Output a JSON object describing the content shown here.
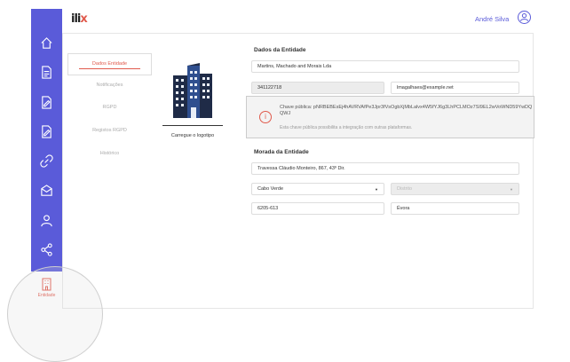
{
  "app": {
    "logo_text": "ilix",
    "logo_accent_color": "#e05a4c",
    "brand_color": "#5a5bd9"
  },
  "header": {
    "user_name": "André Silva"
  },
  "sidebar": {
    "items": [
      {
        "icon": "home-icon"
      },
      {
        "icon": "document-icon"
      },
      {
        "icon": "edit-document-icon"
      },
      {
        "icon": "edit-document-icon-2"
      },
      {
        "icon": "link-icon"
      },
      {
        "icon": "mail-icon"
      },
      {
        "icon": "user-icon"
      },
      {
        "icon": "share-icon"
      }
    ],
    "active": {
      "icon": "building-icon",
      "label": "Entidade"
    }
  },
  "tabs": [
    "Dados Entidade",
    "Notificações",
    "RGPD",
    "Registos RGPD",
    "Histórico"
  ],
  "logo_upload": {
    "label": "Carregue o logotipo"
  },
  "entity": {
    "section_title": "Dados da Entidade",
    "name": "Martins, Machado and Morais Lda",
    "nif": "341122718",
    "email": "lmagalhaes@example.net",
    "notice": {
      "text": "Chave pública: pNRBEBEsEj4hAVRVAfPe3Jpr3fVsOgbXjMbLalvx4W5fYJ6g3LhPCLMOz7SI9EL2wVoWND59YwDQQWJ",
      "hint": "Esta chave pública possibilita a integração com outras plataformas."
    }
  },
  "address": {
    "section_title": "Morada da Entidade",
    "street": "Travessa Cláudio Monteiro, 867, 43º Dir.",
    "country": "Cabo Verde",
    "district_placeholder": "Distrito",
    "postal_code": "6205-613",
    "city": "Évora"
  }
}
